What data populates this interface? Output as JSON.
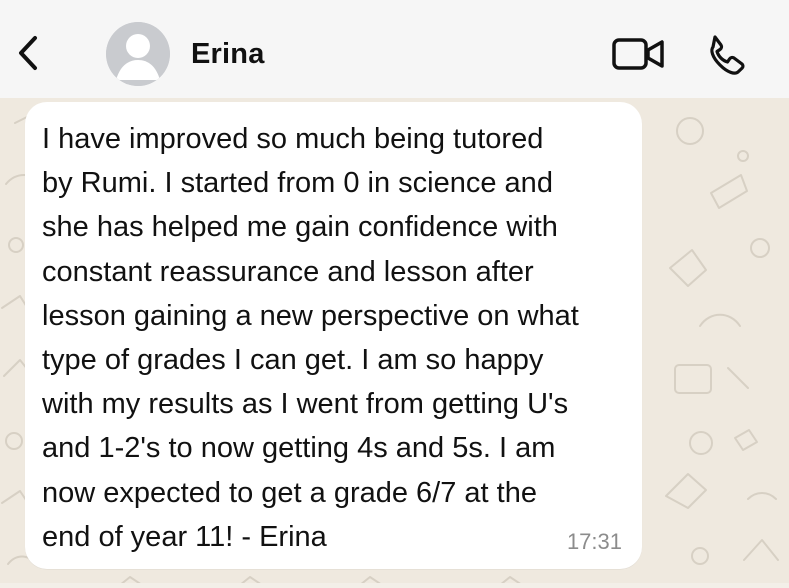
{
  "header": {
    "contact_name": "Erina",
    "back_icon": "chevron-left-icon",
    "avatar_icon": "default-avatar",
    "video_icon": "video-camera-icon",
    "call_icon": "phone-icon"
  },
  "message": {
    "text": "I have improved so much being tutored\nby Rumi. I started from 0 in science and\nshe has helped me gain confidence with\nconstant reassurance and lesson after\nlesson gaining a new perspective on what\ntype of grades I can get. I am so happy\nwith my results as I went from getting U's\nand 1-2's to now getting 4s and 5s. I am\nnow expected to get a grade 6/7 at the\nend of year 11! - Erina",
    "time": "17:31"
  },
  "theme": {
    "header_bg": "#f6f6f6",
    "chat_bg": "#efe9df",
    "bubble_bg": "#ffffff"
  }
}
